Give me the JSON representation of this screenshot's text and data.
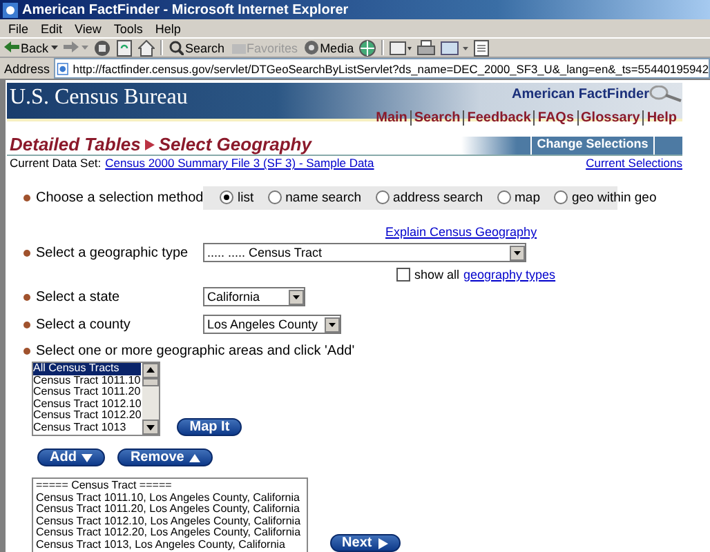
{
  "window": {
    "title": "American FactFinder - Microsoft Internet Explorer"
  },
  "menu": [
    "File",
    "Edit",
    "View",
    "Tools",
    "Help"
  ],
  "toolbar": [
    {
      "kind": "back",
      "label": "Back",
      "disabled": false
    },
    {
      "kind": "search",
      "label": "Search",
      "disabled": false
    },
    {
      "kind": "favorites",
      "label": "Favorites",
      "disabled": true
    },
    {
      "kind": "media",
      "label": "Media",
      "disabled": false
    }
  ],
  "address": {
    "label": "Address",
    "url": "http://factfinder.census.gov/servlet/DTGeoSearchByListServlet?ds_name=DEC_2000_SF3_U&_lang=en&_ts=55440195942"
  },
  "header": {
    "agency": "U.S. Census Bureau",
    "product": "American FactFinder",
    "nav": [
      "Main",
      "Search",
      "Feedback",
      "FAQs",
      "Glossary",
      "Help"
    ],
    "breadcrumb": [
      "Detailed Tables",
      "Select Geography"
    ],
    "change_selections": "Change Selections",
    "dataset_label": "Current Data Set:",
    "dataset": "Census 2000 Summary File 3 (SF 3) - Sample Data",
    "current_selections": "Current Selections"
  },
  "method": {
    "label": "Choose a selection method",
    "options": [
      {
        "label": "list",
        "selected": true
      },
      {
        "label": "name search",
        "selected": false
      },
      {
        "label": "address search",
        "selected": false
      },
      {
        "label": "map",
        "selected": false
      },
      {
        "label": "geo within geo",
        "selected": false
      }
    ]
  },
  "explain_link": "Explain Census Geography",
  "geo_type": {
    "label": "Select a geographic type",
    "value": "..... ..... Census Tract"
  },
  "show_all": {
    "checked": false,
    "label": "show all",
    "link": "geography types"
  },
  "state": {
    "label": "Select a state",
    "value": "California"
  },
  "county": {
    "label": "Select a county",
    "value": "Los Angeles County"
  },
  "areas": {
    "label": "Select one or more geographic areas and click 'Add'",
    "items": [
      {
        "label": "All Census Tracts",
        "selected": true
      },
      {
        "label": "Census Tract 1011.10",
        "selected": false
      },
      {
        "label": "Census Tract 1011.20",
        "selected": false
      },
      {
        "label": "Census Tract 1012.10",
        "selected": false
      },
      {
        "label": "Census Tract 1012.20",
        "selected": false
      },
      {
        "label": "Census Tract 1013",
        "selected": false
      }
    ]
  },
  "map_button": "Map It",
  "add_button": "Add",
  "remove_button": "Remove",
  "selected_areas": [
    "===== Census Tract =====",
    "Census Tract 1011.10, Los Angeles County, California",
    "Census Tract 1011.20, Los Angeles County, California",
    "Census Tract 1012.10, Los Angeles County, California",
    "Census Tract 1012.20, Los Angeles County, California",
    "Census Tract 1013, Los Angeles County, California"
  ],
  "next_button": "Next"
}
